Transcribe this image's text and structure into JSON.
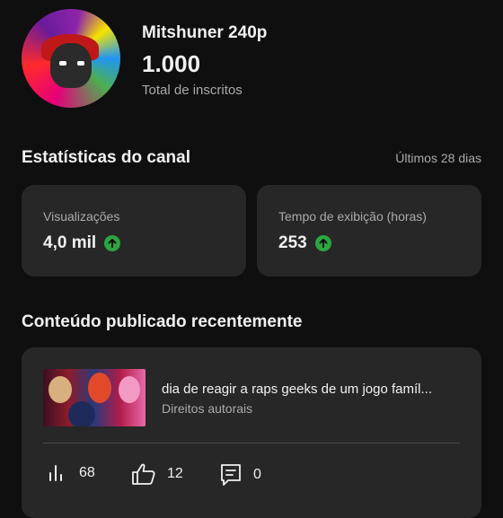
{
  "channel": {
    "name": "Mitshuner 240p",
    "subscribers": "1.000",
    "subscribers_label": "Total de inscritos"
  },
  "stats": {
    "title": "Estatísticas do canal",
    "period": "Últimos 28 dias",
    "cards": [
      {
        "label": "Visualizações",
        "value": "4,0 mil",
        "trend": "up"
      },
      {
        "label": "Tempo de exibição (horas)",
        "value": "253",
        "trend": "up"
      }
    ]
  },
  "recent": {
    "title": "Conteúdo publicado recentemente",
    "video": {
      "title": "dia de reagir a raps geeks de um jogo famíl...",
      "subtitle": "Direitos autorais",
      "views": "68",
      "likes": "12",
      "comments": "0"
    }
  },
  "colors": {
    "background": "#0f0f0f",
    "card": "#272727",
    "accent_up": "#2ba640"
  },
  "icons": [
    "bar-chart-icon",
    "thumbs-up-icon",
    "comment-icon",
    "arrow-up-icon"
  ]
}
